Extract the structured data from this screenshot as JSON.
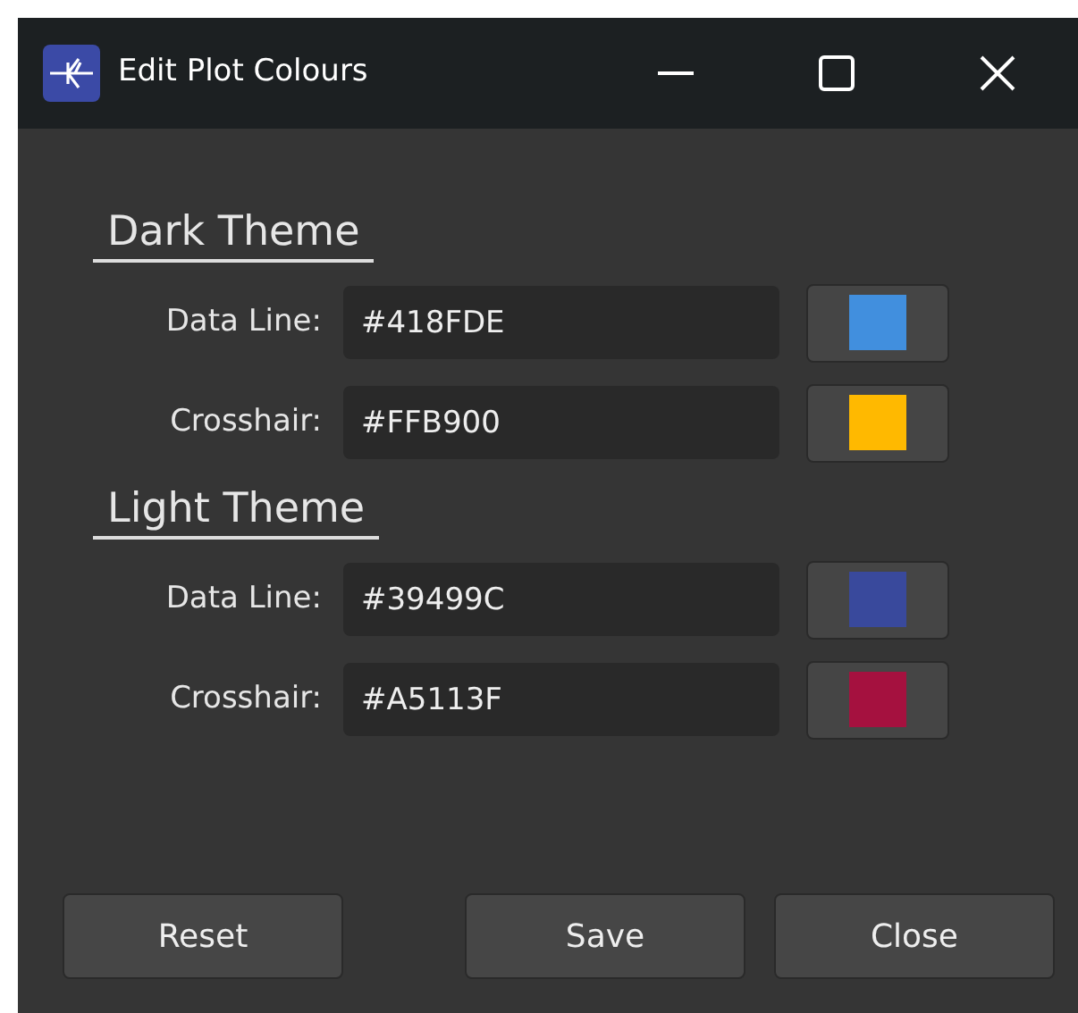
{
  "window": {
    "title": "Edit Plot Colours"
  },
  "sections": [
    {
      "title": "Dark Theme",
      "rows": [
        {
          "label": "Data Line:",
          "value": "#418FDE",
          "color": "#418fde"
        },
        {
          "label": "Crosshair:",
          "value": "#FFB900",
          "color": "#ffb900"
        }
      ]
    },
    {
      "title": "Light Theme",
      "rows": [
        {
          "label": "Data Line:",
          "value": "#39499C",
          "color": "#39499c"
        },
        {
          "label": "Crosshair:",
          "value": "#A5113F",
          "color": "#a5113f"
        }
      ]
    }
  ],
  "buttons": [
    {
      "label": "Reset",
      "kind": "left"
    },
    {
      "label": "Save",
      "kind": "right"
    },
    {
      "label": "Close",
      "kind": "right"
    }
  ]
}
